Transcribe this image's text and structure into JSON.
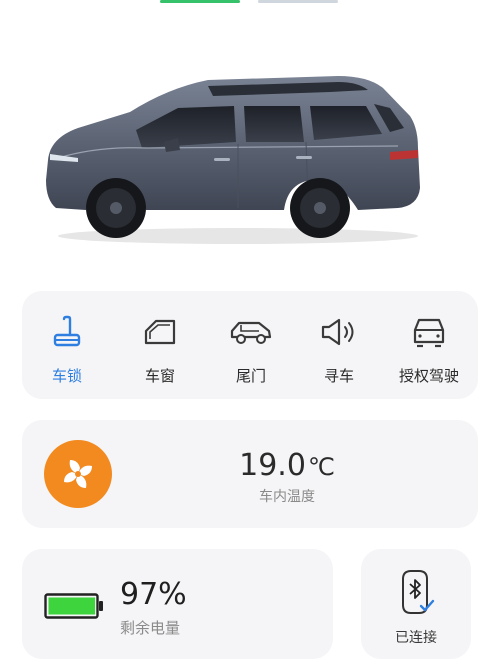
{
  "controls": [
    {
      "label": "车锁",
      "icon": "lock-icon",
      "active": true
    },
    {
      "label": "车窗",
      "icon": "window-icon",
      "active": false
    },
    {
      "label": "尾门",
      "icon": "tailgate-icon",
      "active": false
    },
    {
      "label": "寻车",
      "icon": "find-car-icon",
      "active": false
    },
    {
      "label": "授权驾驶",
      "icon": "authorized-drive-icon",
      "active": false
    }
  ],
  "climate": {
    "temperature": "19.0",
    "unit": "℃",
    "label": "车内温度",
    "icon": "fan-icon"
  },
  "battery": {
    "level": 0.97,
    "percent_text": "97%",
    "label": "剩余电量",
    "icon": "battery-icon"
  },
  "bluetooth": {
    "status_label": "已连接",
    "icon": "bluetooth-key-icon"
  },
  "colors": {
    "accent": "#2f7fe0",
    "fan_bg": "#f28a1f",
    "battery_fill": "#3ed43e",
    "card_bg": "#f5f5f7"
  }
}
